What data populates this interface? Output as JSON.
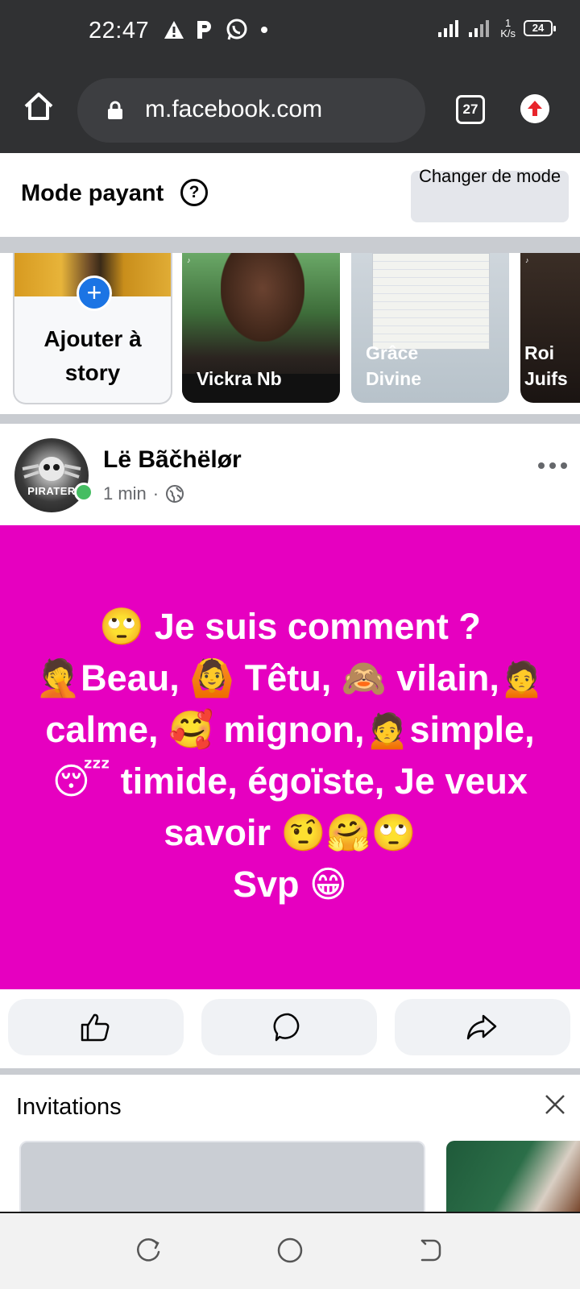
{
  "status_bar": {
    "time": "22:47",
    "net_speed_value": "1",
    "net_speed_unit": "K/s",
    "battery": "24",
    "icons": [
      "warning-icon",
      "parking-icon",
      "whatsapp-icon",
      "dot-icon",
      "signal-icon",
      "signal-3g-icon",
      "battery-icon"
    ]
  },
  "browser": {
    "url": "m.facebook.com",
    "tab_count": "27"
  },
  "mode_bar": {
    "title": "Mode payant",
    "help_symbol": "?",
    "change_button": "Changer de mode"
  },
  "stories": {
    "add_label": "Ajouter à story",
    "items": [
      {
        "name": "Vickra Nb"
      },
      {
        "name": "Grâce Divine"
      },
      {
        "name": "Roi Juifs"
      }
    ]
  },
  "post": {
    "author": "Lë Bãčhëlør",
    "time": "1 min",
    "separator": "·",
    "avatar_text": "PIRATER",
    "body_lines": [
      "🙄 Je suis comment ?",
      "🤦Beau, 🙆 Têtu, 🙈 vilain,🙍",
      "calme, 🥰 mignon,🙍simple,",
      "😴 timide, égoïste, Je veux",
      "savoir 🤨🤗🙄",
      "Svp 😁"
    ],
    "background_color": "#e600c0"
  },
  "invitations": {
    "title": "Invitations"
  }
}
